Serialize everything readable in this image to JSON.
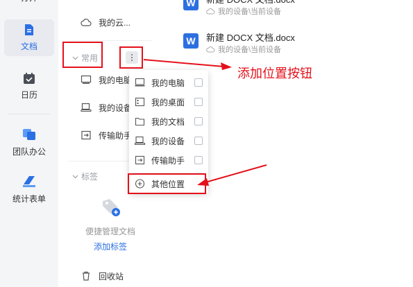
{
  "rail": {
    "items": [
      {
        "label": "打开",
        "icon": "open-icon"
      },
      {
        "label": "文档",
        "icon": "document-icon",
        "active": true
      },
      {
        "label": "日历",
        "icon": "calendar-icon"
      },
      {
        "label": "团队办公",
        "icon": "team-icon"
      },
      {
        "label": "统计表单",
        "icon": "form-icon"
      }
    ]
  },
  "sidebar": {
    "cloud_label": "我的云...",
    "common_header": "常用",
    "common_items": [
      {
        "label": "我的电脑",
        "icon": "computer-icon"
      },
      {
        "label": "我的设备",
        "icon": "device-icon"
      },
      {
        "label": "传输助手",
        "icon": "transfer-icon"
      }
    ],
    "tags_header": "标签",
    "tags_empty_text": "便捷管理文档",
    "tags_add_link": "添加标签",
    "recycle_label": "回收站"
  },
  "main": {
    "docs": [
      {
        "name": "新建 DOCX 文档.docx",
        "path": "我的设备\\当前设备"
      },
      {
        "name": "新建 DOCX 文档.docx",
        "path": "我的设备\\当前设备"
      }
    ]
  },
  "menu": {
    "items": [
      {
        "label": "我的电脑",
        "icon": "computer-icon"
      },
      {
        "label": "我的桌面",
        "icon": "desktop-icon"
      },
      {
        "label": "我的文档",
        "icon": "folder-icon"
      },
      {
        "label": "我的设备",
        "icon": "device-icon"
      },
      {
        "label": "传输助手",
        "icon": "transfer-icon"
      }
    ],
    "other_location": "其他位置"
  },
  "annotation": {
    "text": "添加位置按钮"
  },
  "colors": {
    "accent": "#2b6fe4",
    "annotation_red": "#e4101a",
    "rail_bg": "#f4f5f7"
  }
}
